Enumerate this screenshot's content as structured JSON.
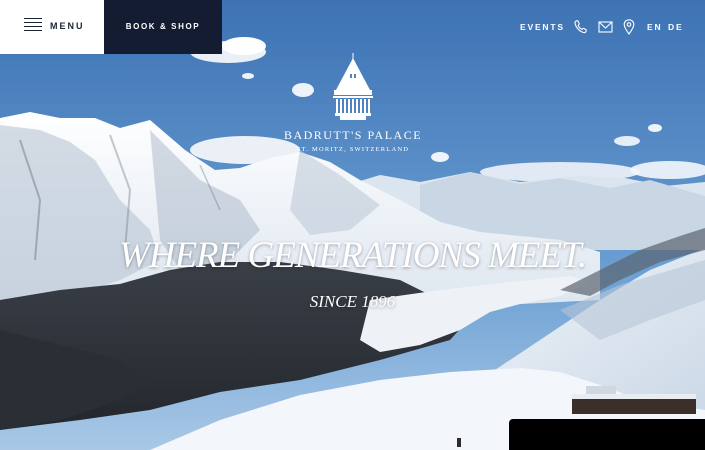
{
  "header": {
    "menu_label": "MENU",
    "book_label": "BOOK & SHOP",
    "events_label": "EVENTS",
    "phone_icon": "phone-icon",
    "mail_icon": "mail-icon",
    "location_icon": "location-pin-icon",
    "lang_en": "EN",
    "lang_de": "DE"
  },
  "brand": {
    "name": "BADRUTT'S PALACE",
    "location": "ST. MORITZ, SWITZERLAND"
  },
  "hero": {
    "headline": "WHERE GENERATIONS MEET.",
    "subheadline": "SINCE 1896"
  },
  "colors": {
    "menu_bg": "#ffffff",
    "book_bg": "#131c31",
    "text_dark": "#1a2434",
    "text_light": "#ffffff"
  }
}
